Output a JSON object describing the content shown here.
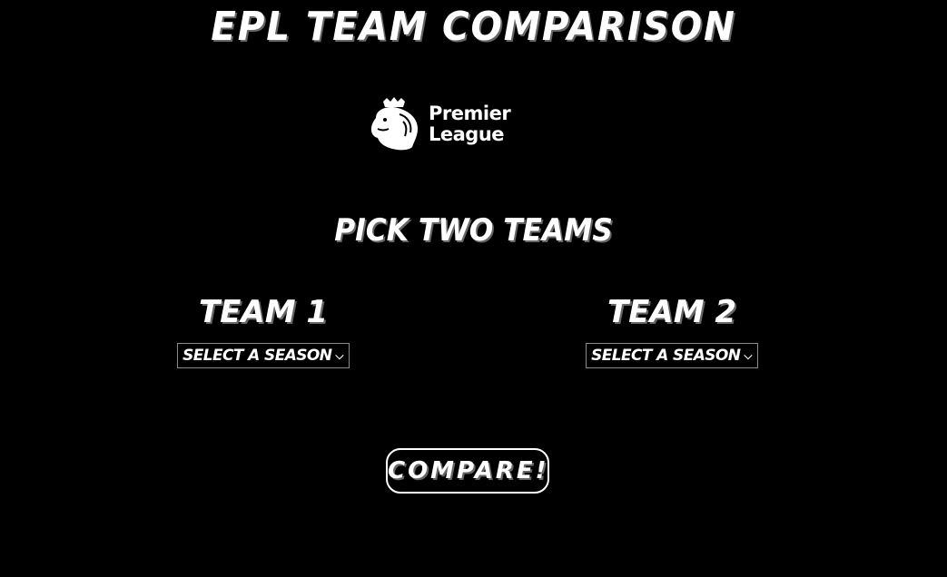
{
  "header": {
    "title": "EPL Team Comparison"
  },
  "logo": {
    "line1": "Premier",
    "line2": "League",
    "icon": "lion-crest-icon"
  },
  "main": {
    "subtitle": "Pick Two Teams",
    "team1": {
      "label": "Team 1",
      "select_value": "Select a Season"
    },
    "team2": {
      "label": "Team 2",
      "select_value": "Select a Season"
    },
    "compare_label": "Compare!"
  },
  "colors": {
    "background": "#000000",
    "text": "#ffffff",
    "border": "#8a8a8a"
  }
}
